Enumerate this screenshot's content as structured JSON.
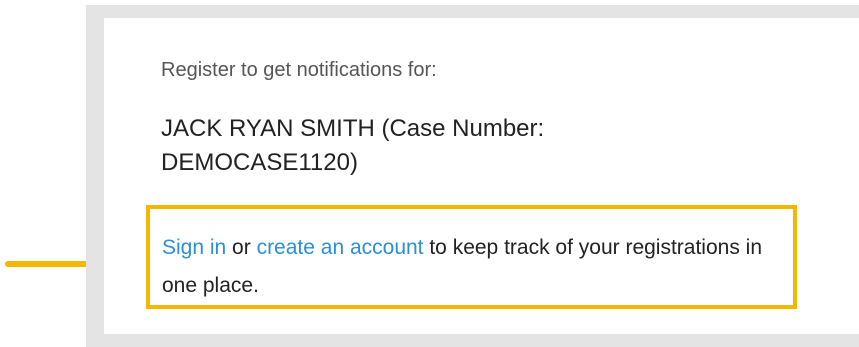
{
  "notification_card": {
    "intro_text": "Register to get notifications for:",
    "case_line": "JACK RYAN SMITH (Case Number: DEMOCASE1120)",
    "signin_prompt": {
      "link_signin": "Sign in",
      "connector": " or ",
      "link_create": "create an account",
      "suffix": " to keep track of your registrations in one place."
    }
  },
  "colors": {
    "highlight_border": "#f5b800",
    "link": "#2a8fd4",
    "frame_background": "#e4e4e4"
  },
  "annotation": {
    "icon": "arrow-right-icon"
  }
}
